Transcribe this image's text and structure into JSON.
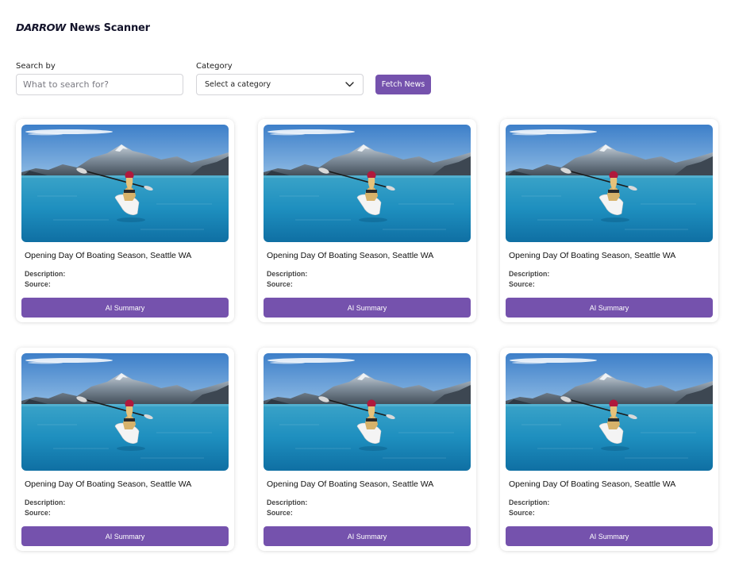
{
  "header": {
    "brand": "DARROW",
    "title": "News Scanner"
  },
  "search": {
    "label": "Search by",
    "placeholder": "What to search for?",
    "value": ""
  },
  "category": {
    "label": "Category",
    "selected": "Select a category"
  },
  "fetch_button": {
    "label": "Fetch News"
  },
  "colors": {
    "accent": "#7552ad",
    "text": "#14142b",
    "border": "#d4d4d8"
  },
  "articles": [
    {
      "title": "Opening Day Of Boating Season, Seattle WA",
      "description_label": "Description:",
      "source_label": "Source:",
      "button_label": "AI Summary"
    },
    {
      "title": "Opening Day Of Boating Season, Seattle WA",
      "description_label": "Description:",
      "source_label": "Source:",
      "button_label": "AI Summary"
    },
    {
      "title": "Opening Day Of Boating Season, Seattle WA",
      "description_label": "Description:",
      "source_label": "Source:",
      "button_label": "AI Summary"
    },
    {
      "title": "Opening Day Of Boating Season, Seattle WA",
      "description_label": "Description:",
      "source_label": "Source:",
      "button_label": "AI Summary"
    },
    {
      "title": "Opening Day Of Boating Season, Seattle WA",
      "description_label": "Description:",
      "source_label": "Source:",
      "button_label": "AI Summary"
    },
    {
      "title": "Opening Day Of Boating Season, Seattle WA",
      "description_label": "Description:",
      "source_label": "Source:",
      "button_label": "AI Summary"
    }
  ]
}
